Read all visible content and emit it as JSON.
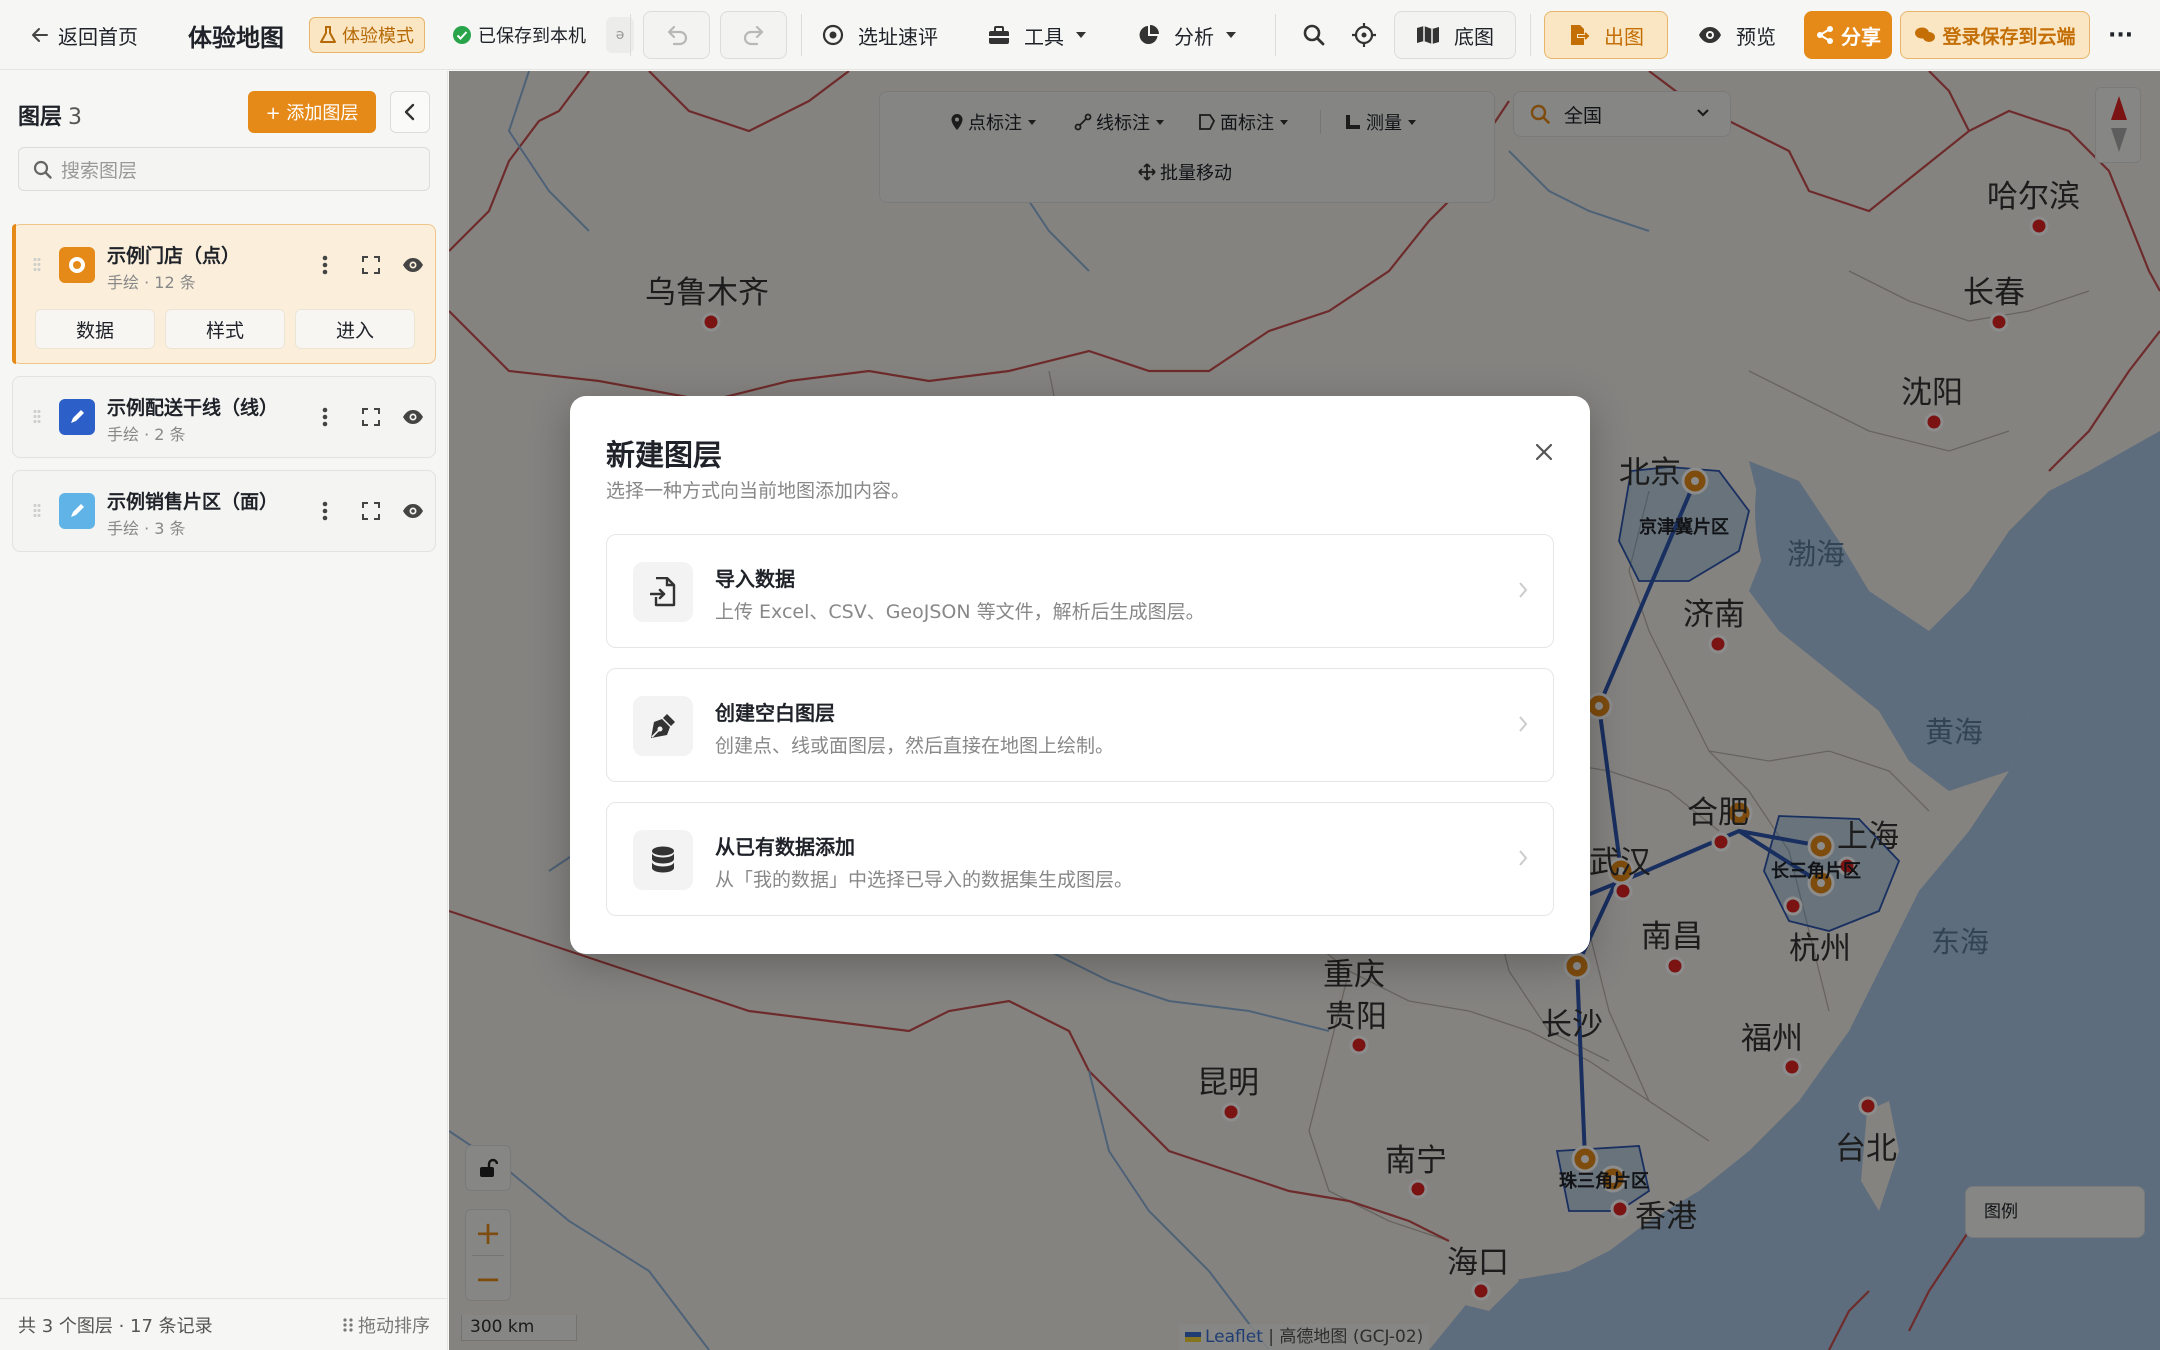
{
  "topbar": {
    "back_label": "返回首页",
    "title": "体验地图",
    "mode_badge": "体验模式",
    "saved_status": "已保存到本机",
    "site_eval": "选址速评",
    "tools": "工具",
    "analysis": "分析",
    "basemap": "底图",
    "export": "出图",
    "preview": "预览",
    "share": "分享",
    "login_save": "登录保存到云端",
    "more": "···"
  },
  "sidebar": {
    "title": "图层",
    "count": "3",
    "add_layer": "+ 添加图层",
    "search_placeholder": "搜索图层",
    "layers": [
      {
        "name": "示例门店（点）",
        "meta": "手绘 · 12 条"
      },
      {
        "name": "示例配送干线（线）",
        "meta": "手绘 · 2 条"
      },
      {
        "name": "示例销售片区（面）",
        "meta": "手绘 · 3 条"
      }
    ],
    "active_buttons": [
      "数据",
      "样式",
      "进入"
    ],
    "footer_summary": "共 3 个图层 · 17 条记录",
    "footer_sort": "拖动排序"
  },
  "draw_toolbar": {
    "point": "点标注",
    "line": "线标注",
    "area": "面标注",
    "measure": "测量",
    "batch_move": "批量移动"
  },
  "region_select": {
    "value": "全国"
  },
  "map": {
    "cities": [
      "乌鲁木齐",
      "哈尔滨",
      "长春",
      "沈阳",
      "北京",
      "济南",
      "合肥",
      "上海",
      "南昌",
      "杭州",
      "武汉",
      "重庆",
      "贵阳",
      "长沙",
      "昆明",
      "福州",
      "台北",
      "南宁",
      "香港",
      "海口"
    ],
    "seas": [
      "渤海",
      "黄海",
      "东海"
    ],
    "regions": [
      "京津冀片区",
      "长三角片区",
      "珠三角片区"
    ],
    "scale": "300 km",
    "attribution_leaflet": "Leaflet",
    "attribution_rest": "| 高德地图 (GCJ-02)",
    "legend": "图例"
  },
  "modal": {
    "title": "新建图层",
    "subtitle": "选择一种方式向当前地图添加内容。",
    "options": [
      {
        "title": "导入数据",
        "desc": "上传 Excel、CSV、GeoJSON 等文件，解析后生成图层。",
        "icon": "file-import-icon"
      },
      {
        "title": "创建空白图层",
        "desc": "创建点、线或面图层，然后直接在地图上绘制。",
        "icon": "pen-nib-icon"
      },
      {
        "title": "从已有数据添加",
        "desc": "从「我的数据」中选择已导入的数据集生成图层。",
        "icon": "database-icon"
      }
    ]
  },
  "colors": {
    "accent": "#e58a18",
    "accent_light": "#fbefdc",
    "route_blue": "#2f56b0",
    "water": "#aac6e4"
  }
}
